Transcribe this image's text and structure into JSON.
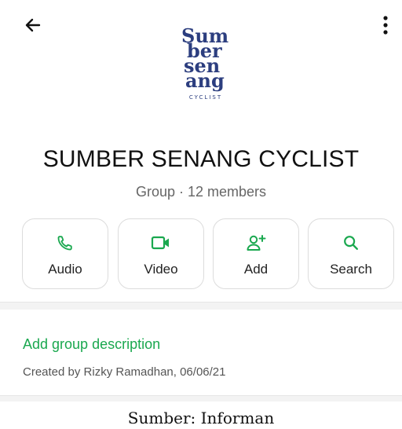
{
  "topbar": {
    "back_icon": "arrow-left-icon",
    "menu_icon": "more-vertical-icon"
  },
  "logo": {
    "icon": "sumber-senang-logo",
    "lines": [
      "Sum",
      "ber",
      "sen",
      "ang"
    ],
    "tagline": "CYCLIST",
    "color": "#2c3e7f"
  },
  "group": {
    "name": "SUMBER SENANG CYCLIST",
    "subtitle": "Group · 12 members"
  },
  "actions": [
    {
      "label": "Audio",
      "icon": "phone-icon"
    },
    {
      "label": "Video",
      "icon": "video-camera-icon"
    },
    {
      "label": "Add",
      "icon": "add-person-icon"
    },
    {
      "label": "Search",
      "icon": "search-icon"
    }
  ],
  "description": {
    "link": "Add group description",
    "created": "Created by Rizky Ramadhan, 06/06/21"
  },
  "caption": "Sumber: Informan",
  "colors": {
    "accent": "#1aa84f",
    "logo": "#2c3e7f"
  }
}
